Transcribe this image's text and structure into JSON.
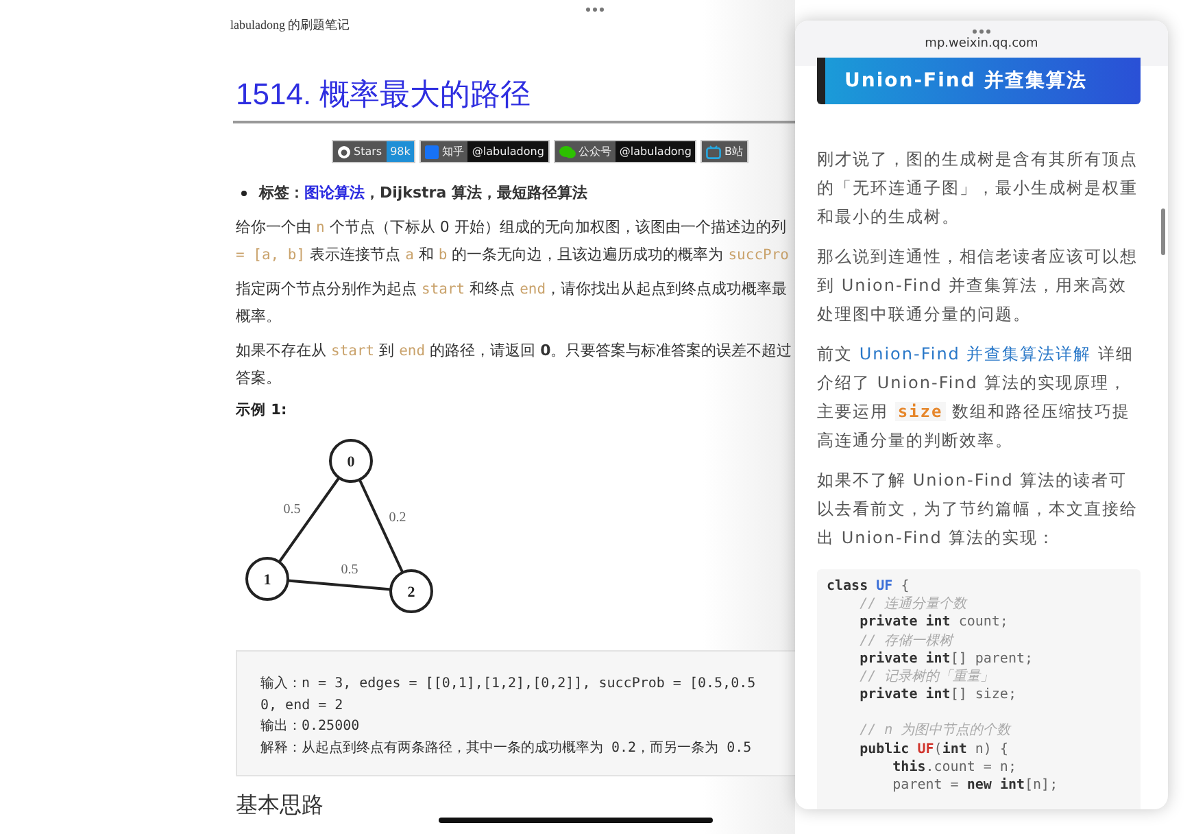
{
  "document": {
    "header": "labuladong 的刷题笔记",
    "title": "1514. 概率最大的路径",
    "badges": [
      {
        "label": "Stars",
        "value": "98k",
        "color": "#1f8fd6"
      },
      {
        "label": "知乎",
        "value": "@labuladong",
        "color": "#111111"
      },
      {
        "label": "公众号",
        "value": "@labuladong",
        "color": "#111111"
      },
      {
        "label": "B站"
      }
    ],
    "tags": [
      {
        "kind": "bold",
        "text": "标签："
      },
      {
        "kind": "link",
        "text": "图论算法"
      },
      {
        "kind": "bold",
        "text": "，Dijkstra 算法，最短路径算法"
      }
    ],
    "paragraphs": [
      [
        [
          {
            "kind": "text",
            "text": "给你一个由 "
          },
          {
            "kind": "code",
            "text": "n"
          },
          {
            "kind": "text",
            "text": " 个节点（下标从 0 开始）组成的无向加权图，该图由一个描述边的列"
          }
        ],
        [
          {
            "kind": "code",
            "text": "= [a, b]"
          },
          {
            "kind": "text",
            "text": " 表示连接节点 "
          },
          {
            "kind": "code",
            "text": "a"
          },
          {
            "kind": "text",
            "text": " 和 "
          },
          {
            "kind": "code",
            "text": "b"
          },
          {
            "kind": "text",
            "text": " 的一条无向边，且该边遍历成功的概率为 "
          },
          {
            "kind": "code",
            "text": "succPro"
          }
        ]
      ],
      [
        [
          {
            "kind": "text",
            "text": "指定两个节点分别作为起点 "
          },
          {
            "kind": "code",
            "text": "start"
          },
          {
            "kind": "text",
            "text": " 和终点 "
          },
          {
            "kind": "code",
            "text": "end"
          },
          {
            "kind": "text",
            "text": "，请你找出从起点到终点成功概率最"
          }
        ],
        [
          {
            "kind": "text",
            "text": "概率。"
          }
        ]
      ],
      [
        [
          {
            "kind": "text",
            "text": "如果不存在从 "
          },
          {
            "kind": "code",
            "text": "start"
          },
          {
            "kind": "text",
            "text": " 到 "
          },
          {
            "kind": "code",
            "text": "end"
          },
          {
            "kind": "text",
            "text": " 的路径，请返回 "
          },
          {
            "kind": "bold",
            "text": "0"
          },
          {
            "kind": "text",
            "text": "。只要答案与标准答案的误差不超过"
          }
        ],
        [
          {
            "kind": "text",
            "text": "答案。"
          }
        ]
      ]
    ],
    "example_label": "示例 1:",
    "graph": {
      "nodes": [
        {
          "label": "0"
        },
        {
          "label": "1"
        },
        {
          "label": "2"
        }
      ],
      "edges": [
        {
          "label": "0.5"
        },
        {
          "label": "0.2"
        },
        {
          "label": "0.5"
        }
      ]
    },
    "example_code": [
      "输入：n = 3, edges = [[0,1],[1,2],[0,2]], succProb = [0.5,0.5",
      "0, end = 2",
      "输出：0.25000",
      "解释：从起点到终点有两条路径，其中一条的成功概率为 0.2，而另一条为 0.5"
    ],
    "section_heading": "基本思路"
  },
  "article": {
    "url": "mp.weixin.qq.com",
    "banner": "Union-Find 并查集算法",
    "paragraphs": [
      [
        [
          {
            "kind": "text",
            "text": "刚才说了，图的生成树是含有其所有顶点"
          }
        ],
        [
          {
            "kind": "text",
            "text": "的「无环连通子图」，最小生成树是权重"
          }
        ],
        [
          {
            "kind": "text",
            "text": "和最小的生成树。"
          }
        ]
      ],
      [
        [
          {
            "kind": "text",
            "text": "那么说到连通性，相信老读者应该可以想"
          }
        ],
        [
          {
            "kind": "text",
            "text": "到 Union-Find 并查集算法，用来高效"
          }
        ],
        [
          {
            "kind": "text",
            "text": "处理图中联通分量的问题。"
          }
        ]
      ],
      [
        [
          {
            "kind": "text",
            "text": "前文 "
          },
          {
            "kind": "link",
            "text": "Union-Find 并查集算法详解"
          },
          {
            "kind": "text",
            "text": " 详细"
          }
        ],
        [
          {
            "kind": "text",
            "text": "介绍了 Union-Find 算法的实现原理，"
          }
        ],
        [
          {
            "kind": "text",
            "text": "主要运用 "
          },
          {
            "kind": "code",
            "text": "size"
          },
          {
            "kind": "text",
            "text": " 数组和路径压缩技巧提"
          }
        ],
        [
          {
            "kind": "text",
            "text": "高连通分量的判断效率。"
          }
        ]
      ],
      [
        [
          {
            "kind": "text",
            "text": "如果不了解 Union-Find 算法的读者可"
          }
        ],
        [
          {
            "kind": "text",
            "text": "以去看前文，为了节约篇幅，本文直接给"
          }
        ],
        [
          {
            "kind": "text",
            "text": "出 Union-Find 算法的实现："
          }
        ]
      ]
    ],
    "code": [
      [
        [
          {
            "kind": "kw",
            "text": "class "
          },
          {
            "kind": "type",
            "text": "UF"
          },
          {
            "kind": "plain",
            "text": " {"
          }
        ],
        [
          {
            "kind": "comment",
            "text": "    // 连通分量个数"
          }
        ],
        [
          {
            "kind": "kw",
            "text": "    private int"
          },
          {
            "kind": "plain",
            "text": " count;"
          }
        ],
        [
          {
            "kind": "comment",
            "text": "    // 存储一棵树"
          }
        ],
        [
          {
            "kind": "kw",
            "text": "    private int"
          },
          {
            "kind": "plain",
            "text": "[] parent;"
          }
        ],
        [
          {
            "kind": "comment",
            "text": "    // 记录树的「重量」"
          }
        ],
        [
          {
            "kind": "kw",
            "text": "    private int"
          },
          {
            "kind": "plain",
            "text": "[] size;"
          }
        ]
      ],
      [
        [
          {
            "kind": "comment",
            "text": "    // n 为图中节点的个数"
          }
        ],
        [
          {
            "kind": "kw",
            "text": "    public "
          },
          {
            "kind": "ctor",
            "text": "UF"
          },
          {
            "kind": "plain",
            "text": "("
          },
          {
            "kind": "kw",
            "text": "int"
          },
          {
            "kind": "plain",
            "text": " n) {"
          }
        ],
        [
          {
            "kind": "kw",
            "text": "        this"
          },
          {
            "kind": "plain",
            "text": ".count = n;"
          }
        ],
        [
          {
            "kind": "plain",
            "text": "        parent = "
          },
          {
            "kind": "kw",
            "text": "new int"
          },
          {
            "kind": "plain",
            "text": "[n];"
          }
        ]
      ]
    ]
  }
}
